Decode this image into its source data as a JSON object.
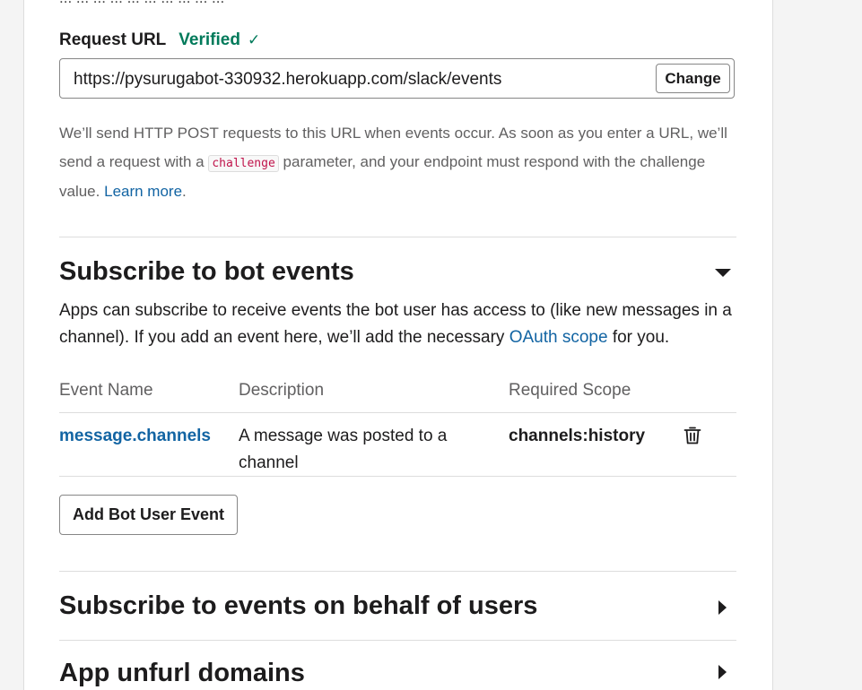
{
  "cutoff_top_text": "... ... ... ... ... ... ... ... ... ...",
  "request_url": {
    "label": "Request URL",
    "status": "Verified",
    "status_icon": "check-icon",
    "value": "https://pysurugabot-330932.herokuapp.com/slack/events",
    "change_label": "Change"
  },
  "help": {
    "part1": "We’ll send HTTP POST requests to this URL when events occur. As soon as you enter a URL, we’ll send a request with a",
    "code": "challenge",
    "part2": "parameter, and your endpoint must respond with the challenge value.",
    "learn_more": "Learn more",
    "end": "."
  },
  "bot_events": {
    "title": "Subscribe to bot events",
    "expanded": true,
    "desc_part1": "Apps can subscribe to receive events the bot user has access to (like new messages in a channel). If you add an event here, we’ll add the necessary",
    "desc_link": "OAuth scope",
    "desc_part2": "for you.",
    "columns": {
      "name": "Event Name",
      "description": "Description",
      "scope": "Required Scope"
    },
    "rows": [
      {
        "name": "message.channels",
        "description": "A message was posted to a channel",
        "scope": "channels:history",
        "delete_icon": "trash-icon"
      }
    ],
    "add_button": "Add Bot User Event"
  },
  "user_events": {
    "title": "Subscribe to events on behalf of users",
    "expanded": false
  },
  "next_section": {
    "title": "App unfurl domains",
    "expanded": false
  },
  "colors": {
    "verified": "#007a5a",
    "link": "#1264a3",
    "code": "#c0134b"
  }
}
